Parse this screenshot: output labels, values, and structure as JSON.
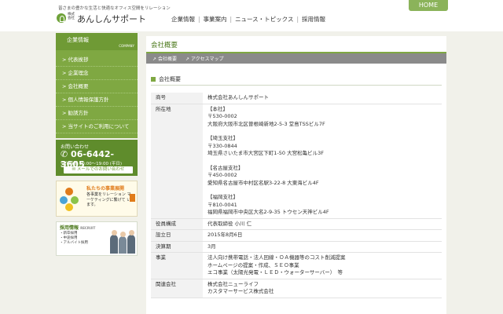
{
  "header": {
    "tagline": "皆さまの豊かな生活と快適なオフィス空間をリレーション",
    "logo_prefix": "株式会社",
    "logo_name": "あんしんサポート",
    "home": "HOME",
    "nav": [
      "企業情報",
      "事業案内",
      "ニュース・トピックス",
      "採用情報"
    ]
  },
  "sidebar": {
    "title": "企業情報",
    "subtitle": "COMPANY",
    "items": [
      "> 代表挨拶",
      "> 企業理念",
      "> 会社概要",
      "> 個人情報保護方針",
      "> 勧誘方針",
      "> 当サイトのご利用について"
    ],
    "contact": {
      "label": "お問い合わせ",
      "tel": "06-6442-3605",
      "hours": "受付時間 10:00〜19:00 (平日)",
      "mail": "メールでのお問い合わせ"
    },
    "banner_business": {
      "title": "私たちの事業展開",
      "text": "各事業をリレーション マーケティングに繋げて います。"
    },
    "banner_recruit": {
      "title": "採用情報",
      "sub": "RECRUIT",
      "items": [
        "・新卒採用",
        "・中途採用",
        "・アルバイト採用"
      ]
    }
  },
  "main": {
    "title": "会社概要",
    "subnav": [
      "会社概要",
      "アクセスマップ"
    ],
    "section": "会社概要",
    "rows": [
      {
        "k": "商号",
        "v": [
          "株式会社あんしんサポート"
        ]
      },
      {
        "k": "所在地",
        "v": [
          "【本社】",
          "〒530-0002",
          "大阪府大阪市北区曽根崎新地2-5-3 堂島TSSビル7F",
          "",
          "【埼玉支社】",
          "〒330-0844",
          "埼玉県さいたま市大宮区下町1-50 大宮松亀ビル3F",
          "",
          "【名古屋支社】",
          "〒450-0002",
          "愛知県名古屋市中村区名駅3-22-8 大東海ビル4F",
          "",
          "【福岡支社】",
          "〒810-0041",
          "福岡県福岡市中央区大名2-9-35 トウセン天神ビル4F"
        ]
      },
      {
        "k": "役員構成",
        "v": [
          "代表取締役 小川 仁"
        ]
      },
      {
        "k": "設立日",
        "v": [
          "2015年8月6日"
        ]
      },
      {
        "k": "決算期",
        "v": [
          "3月"
        ]
      },
      {
        "k": "事業",
        "v": [
          "法人向け携帯電話・法人回線・ＯＡ機器等のコスト削減提案",
          "ホームページの提案・作成、ＳＥＯ事業",
          "エコ事業（太陽光発電・ＬＥＤ・ウォーターサーバー）　等"
        ]
      },
      {
        "k": "関連会社",
        "v": [
          "株式会社ニューライフ",
          "カスタマーサービス株式会社"
        ]
      }
    ]
  },
  "colors": {
    "accent": "#7fa842",
    "dark_green": "#5f8c2c",
    "orange": "#e07b1a"
  }
}
